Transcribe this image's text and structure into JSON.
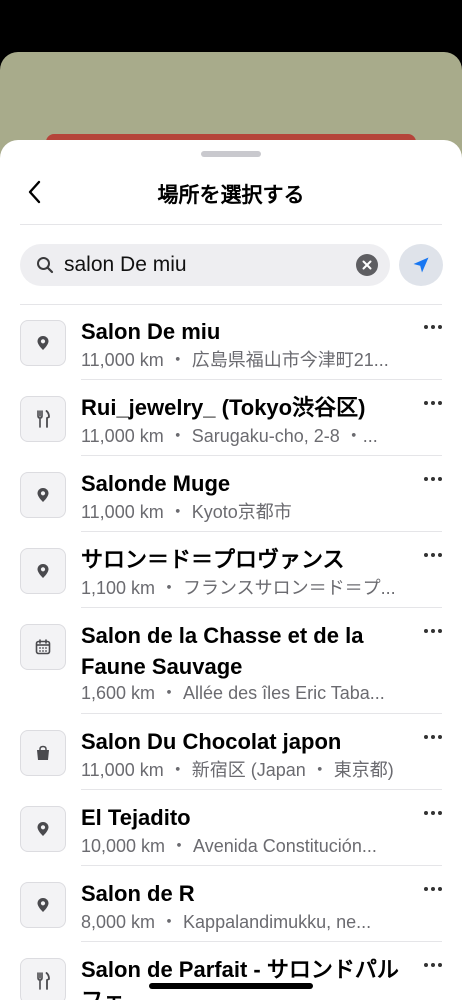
{
  "header": {
    "title": "場所を選択する"
  },
  "search": {
    "value": "salon De miu"
  },
  "results": [
    {
      "name": "Salon De miu",
      "sub": "11,000 km ・ 広島県福山市今津町21...",
      "icon": "pin-icon"
    },
    {
      "name": "Rui_jewelry_ (Tokyo渋谷区)",
      "sub": "11,000 km ・ Sarugaku-cho, 2-8 ・...",
      "icon": "fork-knife-icon"
    },
    {
      "name": "Salonde Muge",
      "sub": "11,000 km ・ Kyoto京都市",
      "icon": "pin-icon"
    },
    {
      "name": "サロン＝ド＝プロヴァンス",
      "sub": "1,100 km ・ フランスサロン＝ド＝プ...",
      "icon": "pin-icon"
    },
    {
      "name": "Salon de la Chasse et de la Faune Sauvage",
      "sub": "1,600 km ・ Allée des îles Eric Taba...",
      "icon": "calendar-icon"
    },
    {
      "name": "Salon Du Chocolat japon",
      "sub": "11,000 km ・ 新宿区 (Japan ・ 東京都)",
      "icon": "shopping-bag-icon"
    },
    {
      "name": "El Tejadito",
      "sub": "10,000 km ・ Avenida Constitución...",
      "icon": "pin-icon"
    },
    {
      "name": "Salon de R",
      "sub": "8,000 km ・ Kappalandimukku, ne...",
      "icon": "pin-icon"
    },
    {
      "name": "Salon de Parfait - サロンドパルフェ",
      "sub": "",
      "icon": "fork-knife-icon"
    }
  ]
}
